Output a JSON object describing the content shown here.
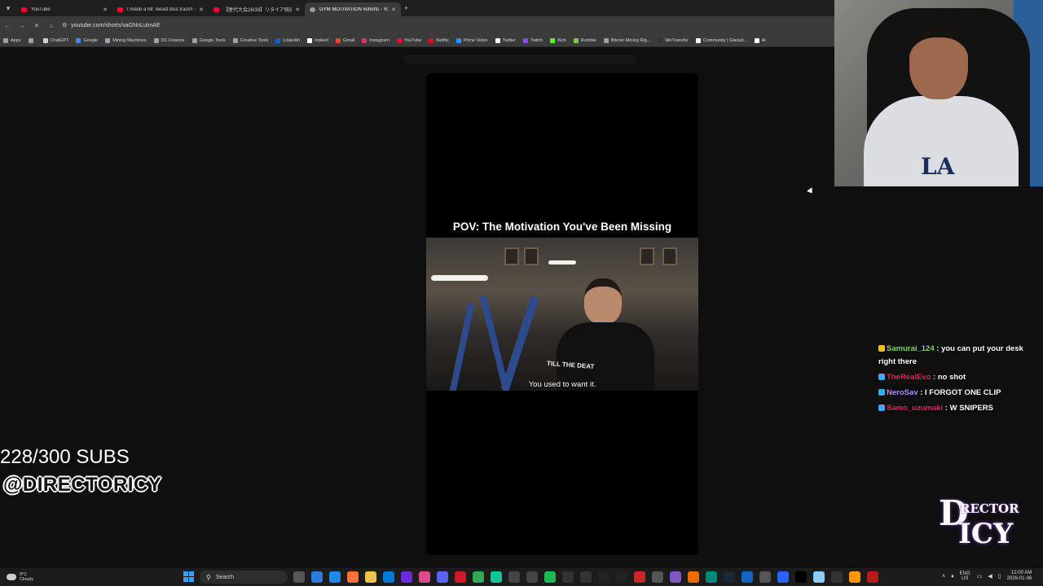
{
  "browser": {
    "tabs": [
      {
        "title": "YouTube",
        "color": "#ff0033",
        "active": false
      },
      {
        "title": "I made a Mr. Beast diss track!! -",
        "color": "#ff0033",
        "active": false
      },
      {
        "title": "【歴代大会28/39】リタイア続出の",
        "color": "#ff0033",
        "active": false
      },
      {
        "title": "GYM MOTIVATION #shorts - Yo",
        "color": "#9aa0a6",
        "active": true
      }
    ],
    "url": "youtube.com/shorts/vaGNnLulmAE",
    "bookmarks": [
      {
        "label": "Apps",
        "color": "#9aa0a6"
      },
      {
        "label": "",
        "color": "#9aa0a6"
      },
      {
        "label": "ChatGPT",
        "color": "#cfcfcf"
      },
      {
        "label": "Google",
        "color": "#4285f4"
      },
      {
        "label": "Mining Machines",
        "color": "#9aa0a6"
      },
      {
        "label": "DC Finance",
        "color": "#9aa0a6"
      },
      {
        "label": "Google Tools",
        "color": "#9aa0a6"
      },
      {
        "label": "Creative Tools",
        "color": "#9aa0a6"
      },
      {
        "label": "LinkedIn",
        "color": "#0a66c2"
      },
      {
        "label": "Indeed",
        "color": "#ffffff"
      },
      {
        "label": "Gmail",
        "color": "#ea4335"
      },
      {
        "label": "Instagram",
        "color": "#e1306c"
      },
      {
        "label": "YouTube",
        "color": "#ff0033"
      },
      {
        "label": "Netflix",
        "color": "#e50914"
      },
      {
        "label": "Prime Video",
        "color": "#1399ff"
      },
      {
        "label": "Twitter",
        "color": "#ffffff"
      },
      {
        "label": "Twitch",
        "color": "#9146ff"
      },
      {
        "label": "Kick",
        "color": "#53fc18"
      },
      {
        "label": "Rumble",
        "color": "#85c742"
      },
      {
        "label": "Bitcoin Mining Rig...",
        "color": "#9aa0a6"
      },
      {
        "label": "WeTransfer",
        "color": "#333333"
      },
      {
        "label": "Community | Glassd...",
        "color": "#ffffff"
      },
      {
        "label": "Ai",
        "color": "#ffffff"
      }
    ]
  },
  "short": {
    "title": "POV: The Motivation You've Been Missing",
    "caption": "You used to want it.",
    "shirt_text": "TILL THE DEAT"
  },
  "chat": [
    {
      "user": "Samurai_124",
      "message": " : you can put your desk right there",
      "color": "#8fd36a",
      "badge": "#f0c020"
    },
    {
      "user": "TheRealEvo",
      "message": " : no shot",
      "color": "#e0245e",
      "badge": "#4aa3ff"
    },
    {
      "user": "NeroSav",
      "message": " : I FORGOT ONE CLIP",
      "color": "#b38cff",
      "badge": "#4aa3ff"
    },
    {
      "user": "Samo_uzumaki",
      "message": " : W SNIPERS",
      "color": "#e0245e",
      "badge": "#4aa3ff"
    }
  ],
  "overlay": {
    "subs": "228/300 SUBS",
    "handle": "@DIRECTORICY",
    "logo_d": "D",
    "logo_rector": "RECTOR",
    "logo_icy": "ICY"
  },
  "webcam": {
    "shirt_logo": "LA"
  },
  "taskbar": {
    "weather_temp": "9°C",
    "weather_desc": "Cloudy",
    "search_placeholder": "Search",
    "apps": [
      {
        "icon": "task-view",
        "color": "#555555"
      },
      {
        "icon": "copilot",
        "color": "#2f7bd9"
      },
      {
        "icon": "edge",
        "color": "#1e88e5"
      },
      {
        "icon": "firefox",
        "color": "#ff7139"
      },
      {
        "icon": "file-explorer",
        "color": "#f2c14e"
      },
      {
        "icon": "outlook",
        "color": "#0078d4"
      },
      {
        "icon": "app-purple",
        "color": "#6a2bd9"
      },
      {
        "icon": "app-pink",
        "color": "#d94c8a"
      },
      {
        "icon": "discord",
        "color": "#5865f2"
      },
      {
        "icon": "opera",
        "color": "#cc1b2b"
      },
      {
        "icon": "chrome",
        "color": "#34a853"
      },
      {
        "icon": "grammarly",
        "color": "#15c39a"
      },
      {
        "icon": "app-gray",
        "color": "#444444"
      },
      {
        "icon": "app-gray-2",
        "color": "#444444"
      },
      {
        "icon": "spotify",
        "color": "#1db954"
      },
      {
        "icon": "app-dark",
        "color": "#333333"
      },
      {
        "icon": "app-dark-2",
        "color": "#333333"
      },
      {
        "icon": "capcut",
        "color": "#222222"
      },
      {
        "icon": "app-m",
        "color": "#222222"
      },
      {
        "icon": "app-red",
        "color": "#c62828"
      },
      {
        "icon": "app-gray-3",
        "color": "#555555"
      },
      {
        "icon": "app-violet",
        "color": "#7e57c2"
      },
      {
        "icon": "app-orange",
        "color": "#ef6c00"
      },
      {
        "icon": "app-teal",
        "color": "#00897b"
      },
      {
        "icon": "steam",
        "color": "#1b2838"
      },
      {
        "icon": "app-blue",
        "color": "#1565c0"
      },
      {
        "icon": "app-gray-4",
        "color": "#555555"
      },
      {
        "icon": "app-blue-2",
        "color": "#2962ff"
      },
      {
        "icon": "x-app",
        "color": "#000000"
      },
      {
        "icon": "app-light",
        "color": "#90caf9"
      },
      {
        "icon": "app-dark-3",
        "color": "#333333"
      },
      {
        "icon": "app-orange-2",
        "color": "#ff9800"
      },
      {
        "icon": "app-red-2",
        "color": "#b71c1c"
      }
    ],
    "lang": "ENG",
    "region": "US",
    "time": "12:00 AM",
    "date": "2026-01-06"
  }
}
